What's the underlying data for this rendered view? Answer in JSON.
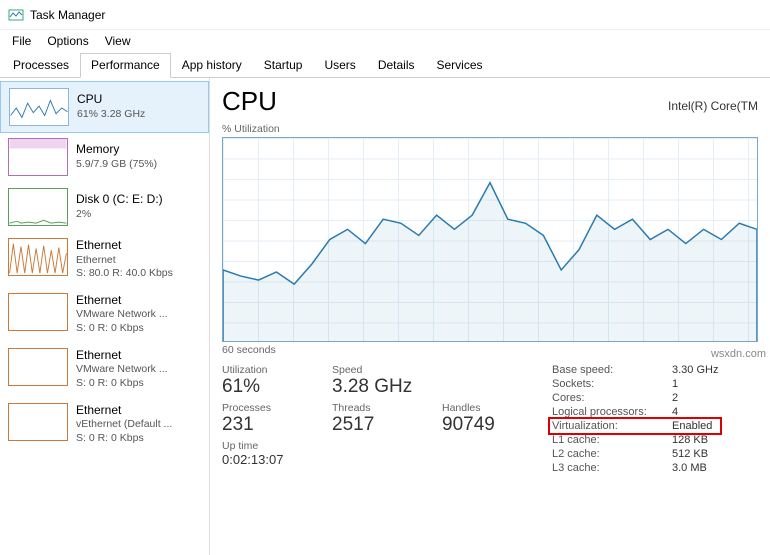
{
  "window": {
    "title": "Task Manager"
  },
  "menubar": {
    "file": "File",
    "options": "Options",
    "view": "View"
  },
  "tabs": [
    "Processes",
    "Performance",
    "App history",
    "Startup",
    "Users",
    "Details",
    "Services"
  ],
  "active_tab": "Performance",
  "sidebar": {
    "items": [
      {
        "name": "CPU",
        "sub1": "61%  3.28 GHz",
        "sub2": ""
      },
      {
        "name": "Memory",
        "sub1": "5.9/7.9 GB (75%)",
        "sub2": ""
      },
      {
        "name": "Disk 0 (C: E: D:)",
        "sub1": "2%",
        "sub2": ""
      },
      {
        "name": "Ethernet",
        "sub1": "Ethernet",
        "sub2": "S: 80.0  R: 40.0 Kbps"
      },
      {
        "name": "Ethernet",
        "sub1": "VMware Network ...",
        "sub2": "S: 0  R: 0 Kbps"
      },
      {
        "name": "Ethernet",
        "sub1": "VMware Network ...",
        "sub2": "S: 0  R: 0 Kbps"
      },
      {
        "name": "Ethernet",
        "sub1": "vEthernet (Default ...",
        "sub2": "S: 0  R: 0 Kbps"
      }
    ]
  },
  "main": {
    "title": "CPU",
    "model": "Intel(R) Core(TM",
    "chart_label": "% Utilization",
    "chart_footer": "60 seconds",
    "stats": {
      "utilization_label": "Utilization",
      "utilization": "61%",
      "speed_label": "Speed",
      "speed": "3.28 GHz",
      "processes_label": "Processes",
      "processes": "231",
      "threads_label": "Threads",
      "threads": "2517",
      "handles_label": "Handles",
      "handles": "90749",
      "uptime_label": "Up time",
      "uptime": "0:02:13:07"
    },
    "right_stats": {
      "base_speed_k": "Base speed:",
      "base_speed_v": "3.30 GHz",
      "sockets_k": "Sockets:",
      "sockets_v": "1",
      "cores_k": "Cores:",
      "cores_v": "2",
      "logical_k": "Logical processors:",
      "logical_v": "4",
      "virt_k": "Virtualization:",
      "virt_v": "Enabled",
      "l1_k": "L1 cache:",
      "l1_v": "128 KB",
      "l2_k": "L2 cache:",
      "l2_v": "512 KB",
      "l3_k": "L3 cache:",
      "l3_v": "3.0 MB"
    }
  },
  "watermark": "wsxdn.com",
  "chart_data": {
    "type": "line",
    "title": "% Utilization",
    "xlabel": "60 seconds",
    "ylabel": "% Utilization",
    "ylim": [
      0,
      100
    ],
    "x": [
      0,
      2,
      4,
      6,
      8,
      10,
      12,
      14,
      16,
      18,
      20,
      22,
      24,
      26,
      28,
      30,
      32,
      34,
      36,
      38,
      40,
      42,
      44,
      46,
      48,
      50,
      52,
      54,
      56,
      58,
      60
    ],
    "values": [
      35,
      32,
      30,
      34,
      28,
      38,
      50,
      55,
      48,
      60,
      58,
      52,
      62,
      55,
      62,
      78,
      60,
      58,
      52,
      35,
      45,
      62,
      55,
      60,
      50,
      55,
      48,
      55,
      50,
      58,
      55
    ]
  }
}
